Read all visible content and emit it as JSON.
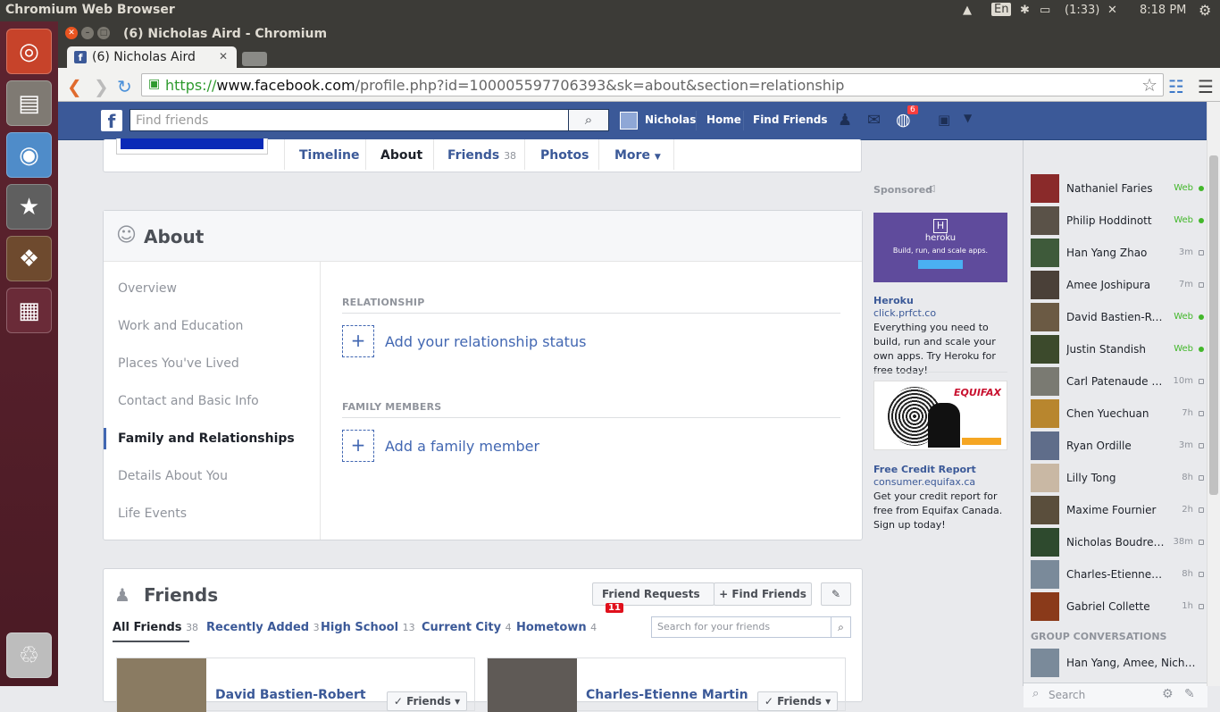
{
  "system": {
    "app_title": "Chromium Web Browser",
    "lang": "En",
    "battery": "(1:33)",
    "time": "8:18 PM"
  },
  "window": {
    "title": "(6) Nicholas Aird - Chromium"
  },
  "tab": {
    "title": "(6) Nicholas Aird",
    "favicon": "f"
  },
  "url": {
    "scheme": "https://",
    "host": "www.facebook.com",
    "path": "/profile.php?id=100005597706393&sk=about&section=relationship"
  },
  "fb": {
    "search_placeholder": "Find friends",
    "user": "Nicholas",
    "home": "Home",
    "find_friends": "Find Friends",
    "notif_count": "6",
    "profile_tabs": [
      {
        "label": "Timeline"
      },
      {
        "label": "About"
      },
      {
        "label": "Friends",
        "count": "38"
      },
      {
        "label": "Photos"
      },
      {
        "label": "More"
      }
    ],
    "about": {
      "heading": "About",
      "nav": [
        "Overview",
        "Work and Education",
        "Places You've Lived",
        "Contact and Basic Info",
        "Family and Relationships",
        "Details About You",
        "Life Events"
      ],
      "relationship_label": "RELATIONSHIP",
      "relationship_add": "Add your relationship status",
      "family_label": "FAMILY MEMBERS",
      "family_add": "Add a family member"
    },
    "friends": {
      "heading": "Friends",
      "requests_label": "Friend Requests",
      "requests_count": "11",
      "find_label": "Find Friends",
      "tabs": [
        {
          "label": "All Friends",
          "count": "38"
        },
        {
          "label": "Recently Added",
          "count": "3"
        },
        {
          "label": "High School",
          "count": "13"
        },
        {
          "label": "Current City",
          "count": "4"
        },
        {
          "label": "Hometown",
          "count": "4"
        }
      ],
      "search_placeholder": "Search for your friends",
      "cards": [
        {
          "name": "David Bastien-Robert",
          "button": "Friends"
        },
        {
          "name": "Charles-Etienne Martin",
          "button": "Friends"
        }
      ]
    },
    "ads": {
      "sponsored": "Sponsored",
      "ad1": {
        "title": "Heroku",
        "url": "click.prfct.co",
        "body": "Everything you need to build, run and scale your own apps. Try Heroku for free today!",
        "img_text": "heroku",
        "img_sub": "Build, run, and scale apps."
      },
      "ad2": {
        "title": "Free Credit Report",
        "url": "consumer.equifax.ca",
        "body": "Get your credit report for free from Equifax Canada. Sign up today!",
        "img_text": "EQUIFAX"
      }
    },
    "chat": {
      "contacts": [
        {
          "name": "Nathaniel Faries",
          "status": "Web"
        },
        {
          "name": "Philip Hoddinott",
          "status": "Web"
        },
        {
          "name": "Han Yang Zhao",
          "status": "3m"
        },
        {
          "name": "Amee Joshipura",
          "status": "7m"
        },
        {
          "name": "David Bastien-Robert",
          "status": "Web"
        },
        {
          "name": "Justin Standish",
          "status": "Web"
        },
        {
          "name": "Carl Patenaude Poulin",
          "status": "10m"
        },
        {
          "name": "Chen Yuechuan",
          "status": "7h"
        },
        {
          "name": "Ryan Ordille",
          "status": "3m"
        },
        {
          "name": "Lilly Tong",
          "status": "8h"
        },
        {
          "name": "Maxime Fournier",
          "status": "2h"
        },
        {
          "name": "Nicholas Boudreau",
          "status": "38m"
        },
        {
          "name": "Charles-Etienne Martin",
          "status": "8h"
        },
        {
          "name": "Gabriel Collette",
          "status": "1h"
        }
      ],
      "group_label": "GROUP CONVERSATIONS",
      "group": "Han Yang, Amee, Nicholas",
      "search_placeholder": "Search"
    }
  },
  "colors": {
    "fb_blue": "#3b5998",
    "link": "#4267b2",
    "online": "#42b72a",
    "launcher": "#5e2430"
  }
}
